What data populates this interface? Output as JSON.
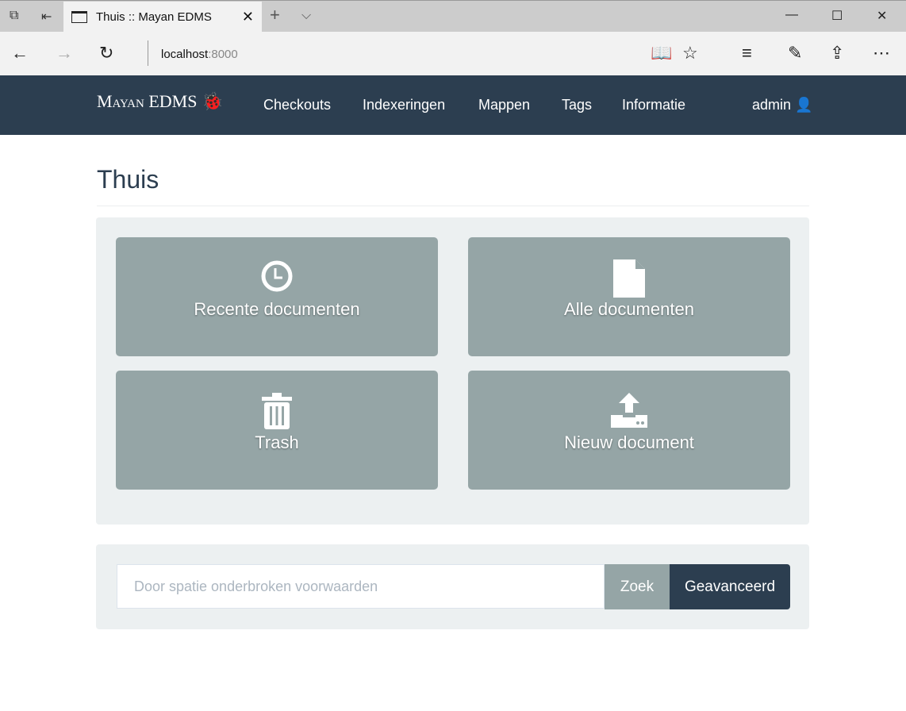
{
  "browser": {
    "tab_title": "Thuis :: Mayan EDMS",
    "url_host": "localhost",
    "url_port": ":8000"
  },
  "nav": {
    "brand": "Mayan EDMS",
    "items": [
      "Checkouts",
      "Indexeringen",
      "Mappen",
      "Tags",
      "Informatie"
    ],
    "user": "admin"
  },
  "page": {
    "title": "Thuis"
  },
  "tiles": [
    {
      "label": "Recente documenten",
      "icon": "clock-icon"
    },
    {
      "label": "Alle documenten",
      "icon": "file-icon"
    },
    {
      "label": "Trash",
      "icon": "trash-icon"
    },
    {
      "label": "Nieuw document",
      "icon": "upload-icon"
    }
  ],
  "search": {
    "placeholder": "Door spatie onderbroken voorwaarden",
    "search_label": "Zoek",
    "advanced_label": "Geavanceerd"
  }
}
